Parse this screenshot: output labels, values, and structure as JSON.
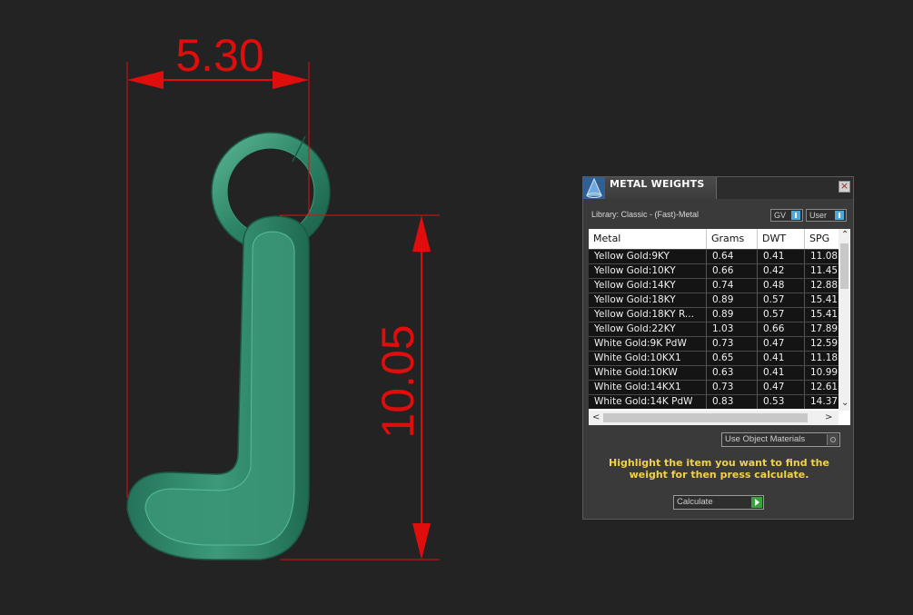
{
  "viewport": {
    "width_dimension": "5.30",
    "height_dimension": "10.05",
    "dimension_color": "#e00d0d",
    "model_color": "#2e8c6c"
  },
  "panel": {
    "title": "METAL WEIGHTS",
    "icon": "app-cone-icon",
    "close_icon": "close-icon",
    "library_label": "Library: Classic - (Fast)-Metal",
    "toggles": {
      "gv": "GV",
      "user": "User"
    },
    "table": {
      "columns": [
        "Metal",
        "Grams",
        "DWT",
        "SPG"
      ],
      "rows": [
        [
          "Yellow Gold:9KY",
          "0.64",
          "0.41",
          "11.08"
        ],
        [
          "Yellow Gold:10KY",
          "0.66",
          "0.42",
          "11.45"
        ],
        [
          "Yellow Gold:14KY",
          "0.74",
          "0.48",
          "12.88"
        ],
        [
          "Yellow Gold:18KY",
          "0.89",
          "0.57",
          "15.41"
        ],
        [
          "Yellow Gold:18KY R...",
          "0.89",
          "0.57",
          "15.41"
        ],
        [
          "Yellow Gold:22KY",
          "1.03",
          "0.66",
          "17.89"
        ],
        [
          "White Gold:9K PdW",
          "0.73",
          "0.47",
          "12.59"
        ],
        [
          "White Gold:10KX1",
          "0.65",
          "0.41",
          "11.18"
        ],
        [
          "White Gold:10KW",
          "0.63",
          "0.41",
          "10.99"
        ],
        [
          "White Gold:14KX1",
          "0.73",
          "0.47",
          "12.61"
        ],
        [
          "White Gold:14K PdW",
          "0.83",
          "0.53",
          "14.37"
        ]
      ]
    },
    "use_object_materials_label": "Use Object Materials",
    "hint": "Highlight the item you want to find the weight for then press calculate.",
    "calculate_label": "Calculate"
  }
}
